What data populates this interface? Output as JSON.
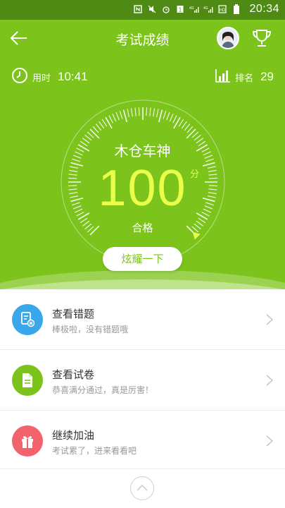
{
  "status_bar": {
    "time": "20:34",
    "icons": [
      "nfc-icon",
      "mute-icon",
      "alarm-icon",
      "sim-icon",
      "4g-signal-icon",
      "4g-signal-icon",
      "hd-icon",
      "battery-icon"
    ]
  },
  "header": {
    "title": "考试成绩"
  },
  "stats": {
    "time_label": "用时",
    "time_value": "10:41",
    "rank_label": "排名",
    "rank_value": "29"
  },
  "result": {
    "name": "木仓车神",
    "score": "100",
    "unit": "分",
    "status": "合格",
    "score_fraction": 1.0
  },
  "share_button": "炫耀一下",
  "list": [
    {
      "title": "查看错题",
      "subtitle": "棒极啦，没有错题哦",
      "icon": "wrong-question-icon",
      "color": "#3aa7ea"
    },
    {
      "title": "查看试卷",
      "subtitle": "恭喜满分通过，真是厉害！",
      "icon": "document-icon",
      "color": "#7cc41c"
    },
    {
      "title": "继续加油",
      "subtitle": "考试累了，进来看看吧",
      "icon": "gift-icon",
      "color": "#f2636b"
    }
  ],
  "colors": {
    "accent": "#7cc41c",
    "score": "#e9ff4a"
  }
}
